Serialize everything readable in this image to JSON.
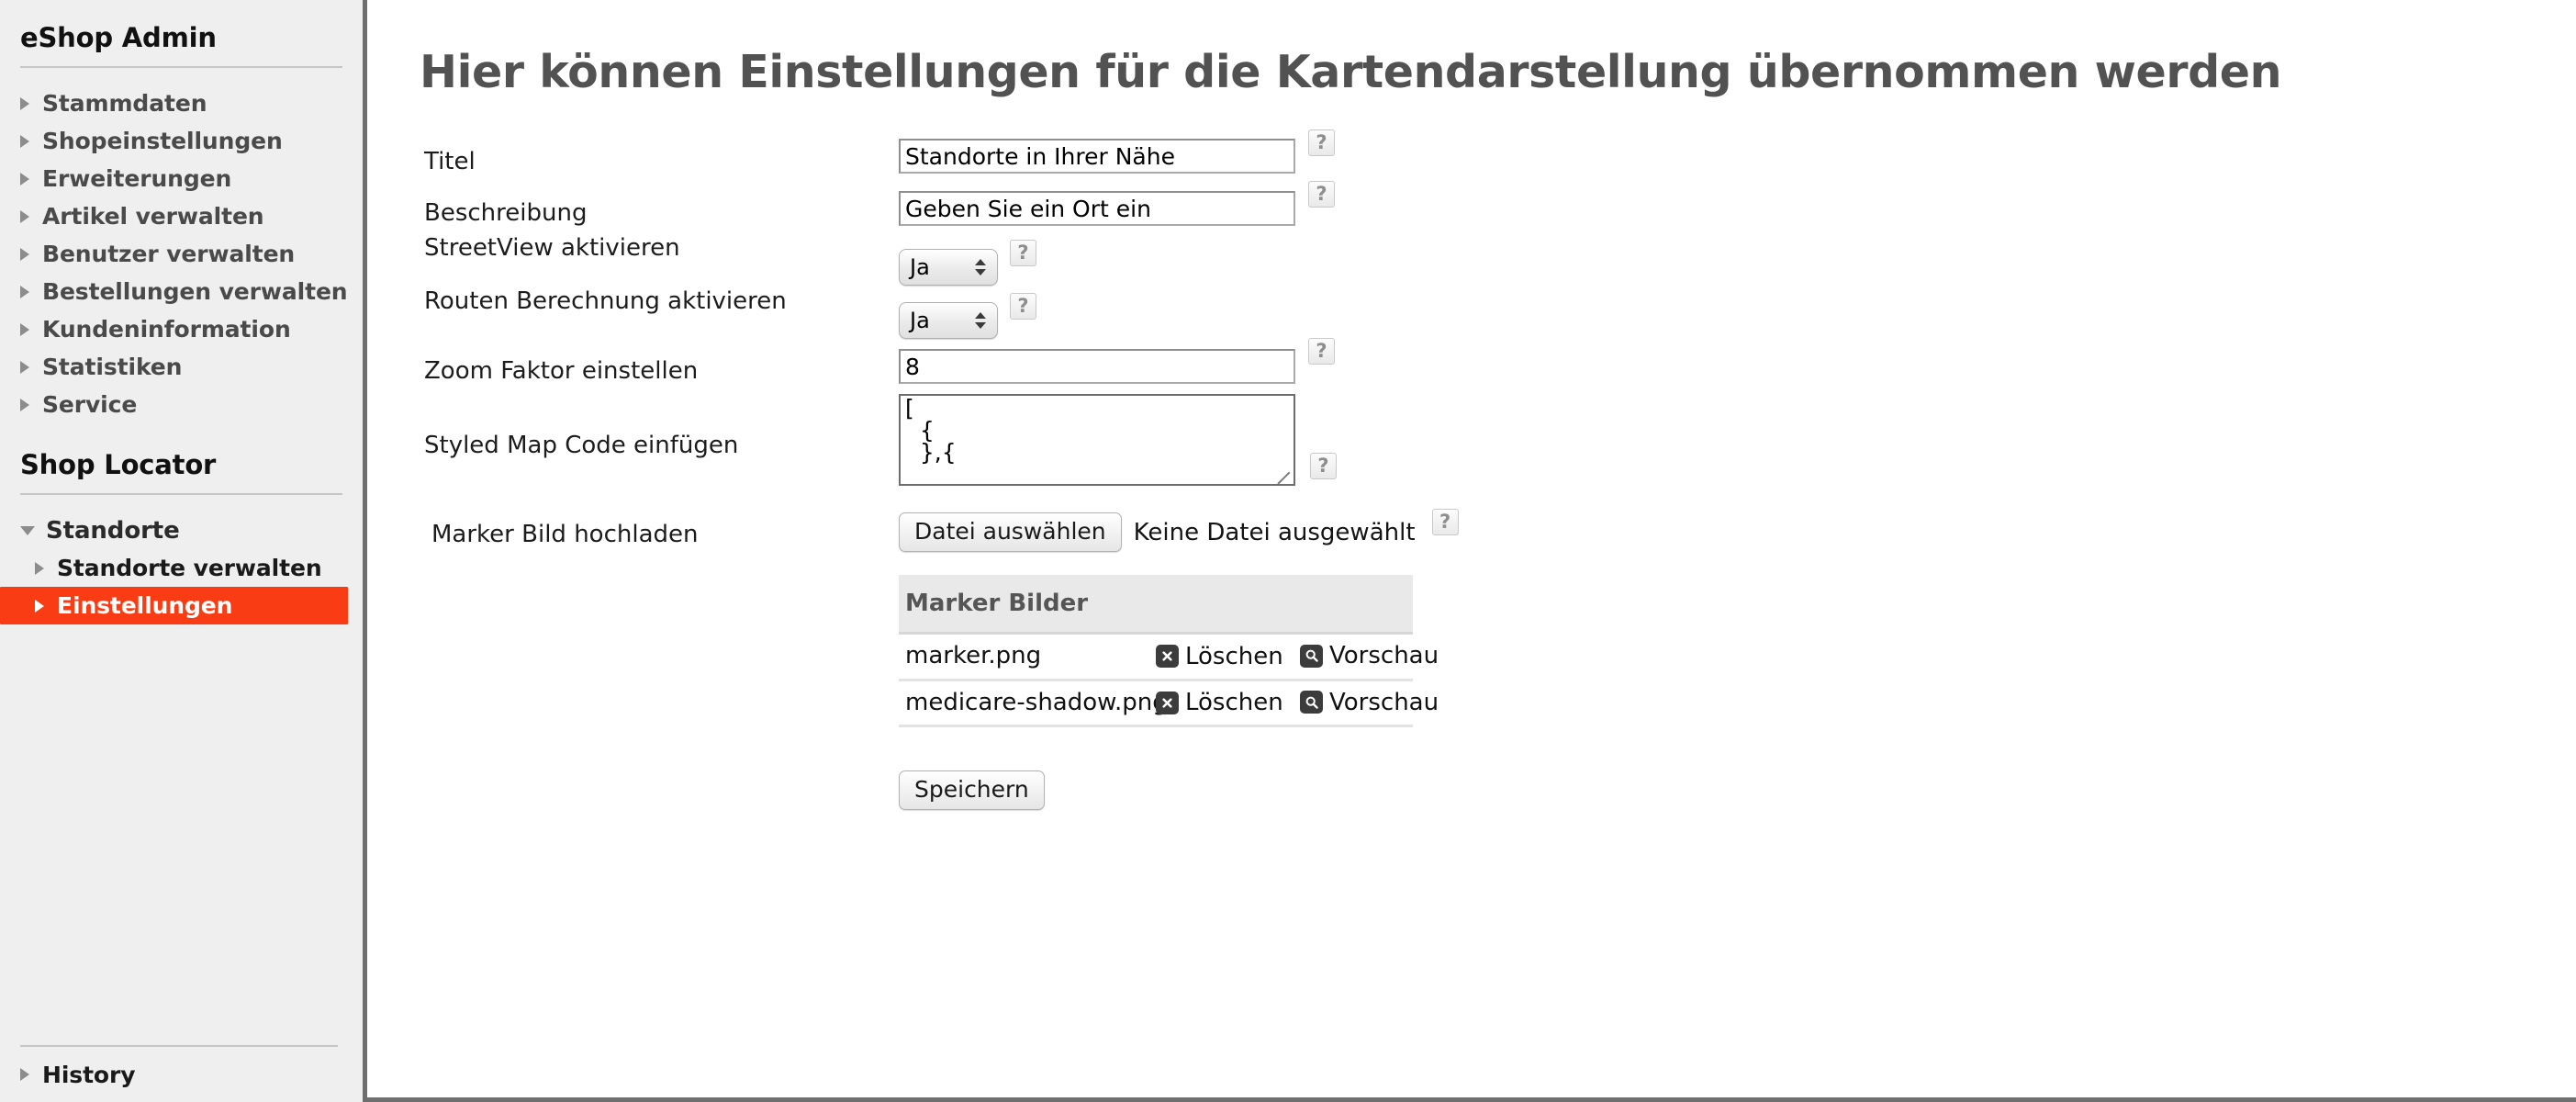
{
  "sidebar": {
    "admin_title": "eShop Admin",
    "admin_items": [
      {
        "label": "Stammdaten"
      },
      {
        "label": "Shopeinstellungen"
      },
      {
        "label": "Erweiterungen"
      },
      {
        "label": "Artikel verwalten"
      },
      {
        "label": "Benutzer verwalten"
      },
      {
        "label": "Bestellungen verwalten"
      },
      {
        "label": "Kundeninformation"
      },
      {
        "label": "Statistiken"
      },
      {
        "label": "Service"
      }
    ],
    "locator_title": "Shop Locator",
    "locator_items": [
      {
        "label": "Standorte"
      },
      {
        "label": "Standorte verwalten"
      },
      {
        "label": "Einstellungen"
      }
    ],
    "history_label": "History",
    "active_color": "#fa3c14"
  },
  "main": {
    "heading": "Hier können Einstellungen für die Kartendarstellung übernommen werden",
    "help_glyph": "?",
    "fields": {
      "titel": {
        "label": "Titel",
        "value": "Standorte in Ihrer Nähe"
      },
      "beschreibung": {
        "label": "Beschreibung",
        "value": "Geben Sie ein Ort ein"
      },
      "streetview": {
        "label": "StreetView aktivieren",
        "value": "Ja"
      },
      "routen": {
        "label": "Routen Berechnung aktivieren",
        "value": "Ja"
      },
      "zoom": {
        "label": "Zoom Faktor einstellen",
        "value": "8"
      },
      "styledmap": {
        "label": "Styled Map Code einfügen",
        "value": "[\n  {\n  },{"
      },
      "marker_upload": {
        "label": "Marker Bild hochladen",
        "button_label": "Datei auswählen",
        "no_file_label": "Keine Datei ausgewählt"
      }
    },
    "marker_table": {
      "header": "Marker Bilder",
      "delete_label": "Löschen",
      "preview_label": "Vorschau",
      "rows": [
        {
          "filename": "marker.png"
        },
        {
          "filename": "medicare-shadow.png"
        }
      ]
    },
    "save_label": "Speichern"
  }
}
